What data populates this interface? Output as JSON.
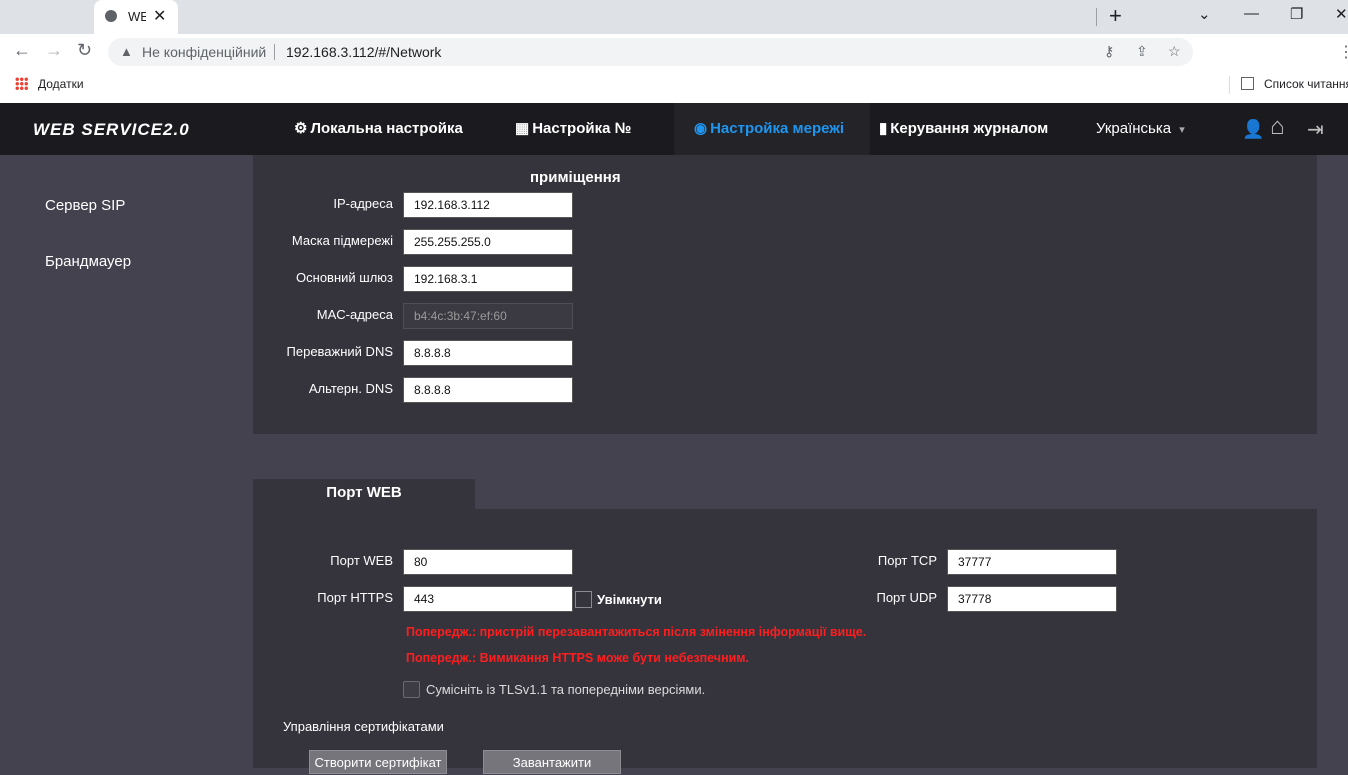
{
  "browser": {
    "tab_title": "WEB",
    "close": "✕",
    "new_tab": "+",
    "window_controls": [
      "⌄",
      "—",
      "❐",
      "✕"
    ],
    "back": "←",
    "forward": "→",
    "reload": "↻",
    "security_icon": "▲",
    "security_label": "Не конфіденційний",
    "url": "192.168.3.112/#/Network",
    "omni_icons": [
      "⚷",
      "⇪",
      "☆"
    ],
    "menu": "⋮",
    "bookmarks_apps": "Додатки",
    "reading_list": "Список читання"
  },
  "header": {
    "logo": "WEB SERVICE2.0",
    "nav": [
      {
        "icon": "⚙",
        "label": "Локальна настройка"
      },
      {
        "icon": "▦",
        "label": "Настройка №"
      },
      {
        "icon": "◉",
        "label": "Настройка мережі"
      },
      {
        "icon": "▮",
        "label": "Керування журналом"
      }
    ],
    "language": "Українська",
    "lang_caret": "▾",
    "user_icon": "👤",
    "home_icon": "⌂",
    "logout_icon": "⇥"
  },
  "sidebar": {
    "items": [
      "Сервер SIP",
      "Брандмауер"
    ]
  },
  "network": {
    "section_title": "приміщення",
    "fields": [
      {
        "label": "IP-адреса",
        "value": "192.168.3.112"
      },
      {
        "label": "Маска підмережі",
        "value": "255.255.255.0"
      },
      {
        "label": "Основний шлюз",
        "value": "192.168.3.1"
      },
      {
        "label": "MAC-адреса",
        "value": "b4:4c:3b:47:ef:60"
      },
      {
        "label": "Переважний DNS",
        "value": "8.8.8.8"
      },
      {
        "label": "Альтерн. DNS",
        "value": "8.8.8.8"
      }
    ]
  },
  "ports": {
    "tab_label": "Порт WEB",
    "web_label": "Порт WEB",
    "web_value": "80",
    "https_label": "Порт HTTPS",
    "https_value": "443",
    "enable_label": "Увімкнути",
    "tcp_label": "Порт TCP",
    "tcp_value": "37777",
    "udp_label": "Порт UDP",
    "udp_value": "37778",
    "warning1": "Попередж.: пристрій перезавантажиться після змінення інформації вище.",
    "warning2": "Попередж.: Вимикання HTTPS може бути небезпечним.",
    "tls_label": "Сумісніть із TLSv1.1 та попередніми версіями.",
    "cert_title": "Управління сертифікатами",
    "create_cert": "Створити сертифікат",
    "upload": "Завантажити"
  },
  "colors": {
    "accent": "#1e96f0",
    "warning": "#ff1e1e",
    "background": "#44424f",
    "panel": "#35343d",
    "header": "#1b1b1f"
  }
}
